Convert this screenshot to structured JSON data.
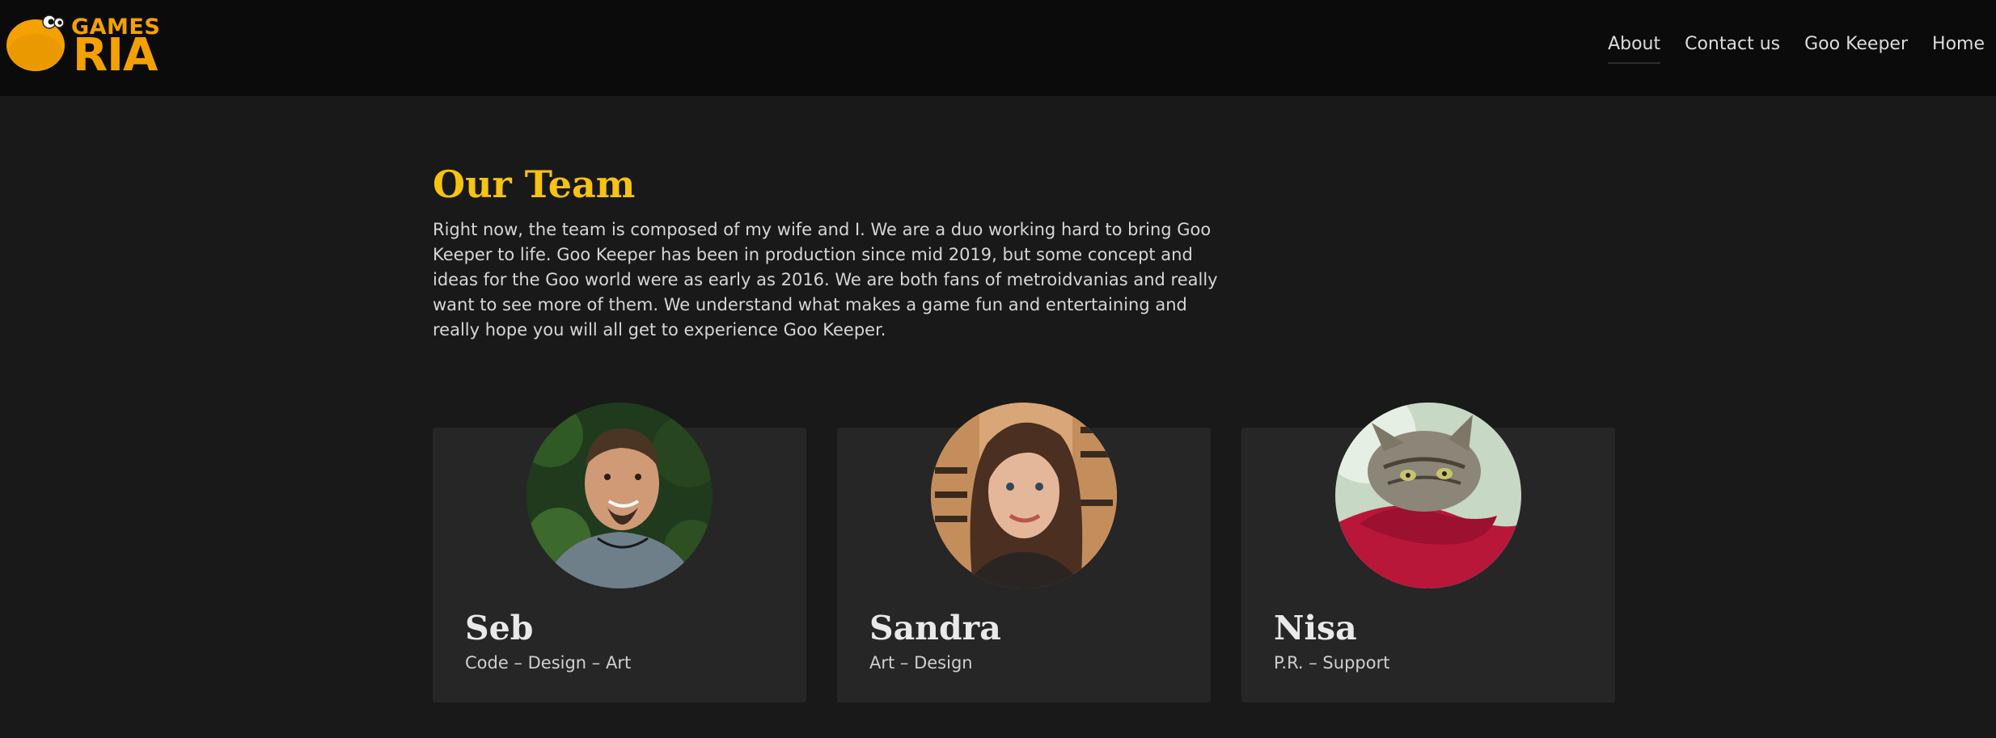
{
  "brand": {
    "logo_line1": "GAMES",
    "logo_line2": "RIA",
    "accent_color": "#f4a100"
  },
  "nav": {
    "items": [
      {
        "label": "About",
        "active": true
      },
      {
        "label": "Contact us",
        "active": false
      },
      {
        "label": "Goo Keeper",
        "active": false
      },
      {
        "label": "Home",
        "active": false
      }
    ]
  },
  "main": {
    "title": "Our Team",
    "title_color": "#f6c312",
    "intro": "Right now, the team is composed of my wife and I. We are a duo working hard to bring Goo Keeper to life. Goo Keeper has been in production since mid 2019, but some concept and ideas for the Goo world were as early as 2016. We are both fans of metroidvanias and really want to see more of them. We understand what makes a game fun and entertaining and really hope you will all get to experience Goo Keeper."
  },
  "team": [
    {
      "name": "Seb",
      "role": "Code – Design – Art",
      "avatar": "photo-man-bearded"
    },
    {
      "name": "Sandra",
      "role": "Art – Design",
      "avatar": "photo-woman-smiling"
    },
    {
      "name": "Nisa",
      "role": "P.R. – Support",
      "avatar": "photo-tabby-cat"
    }
  ]
}
